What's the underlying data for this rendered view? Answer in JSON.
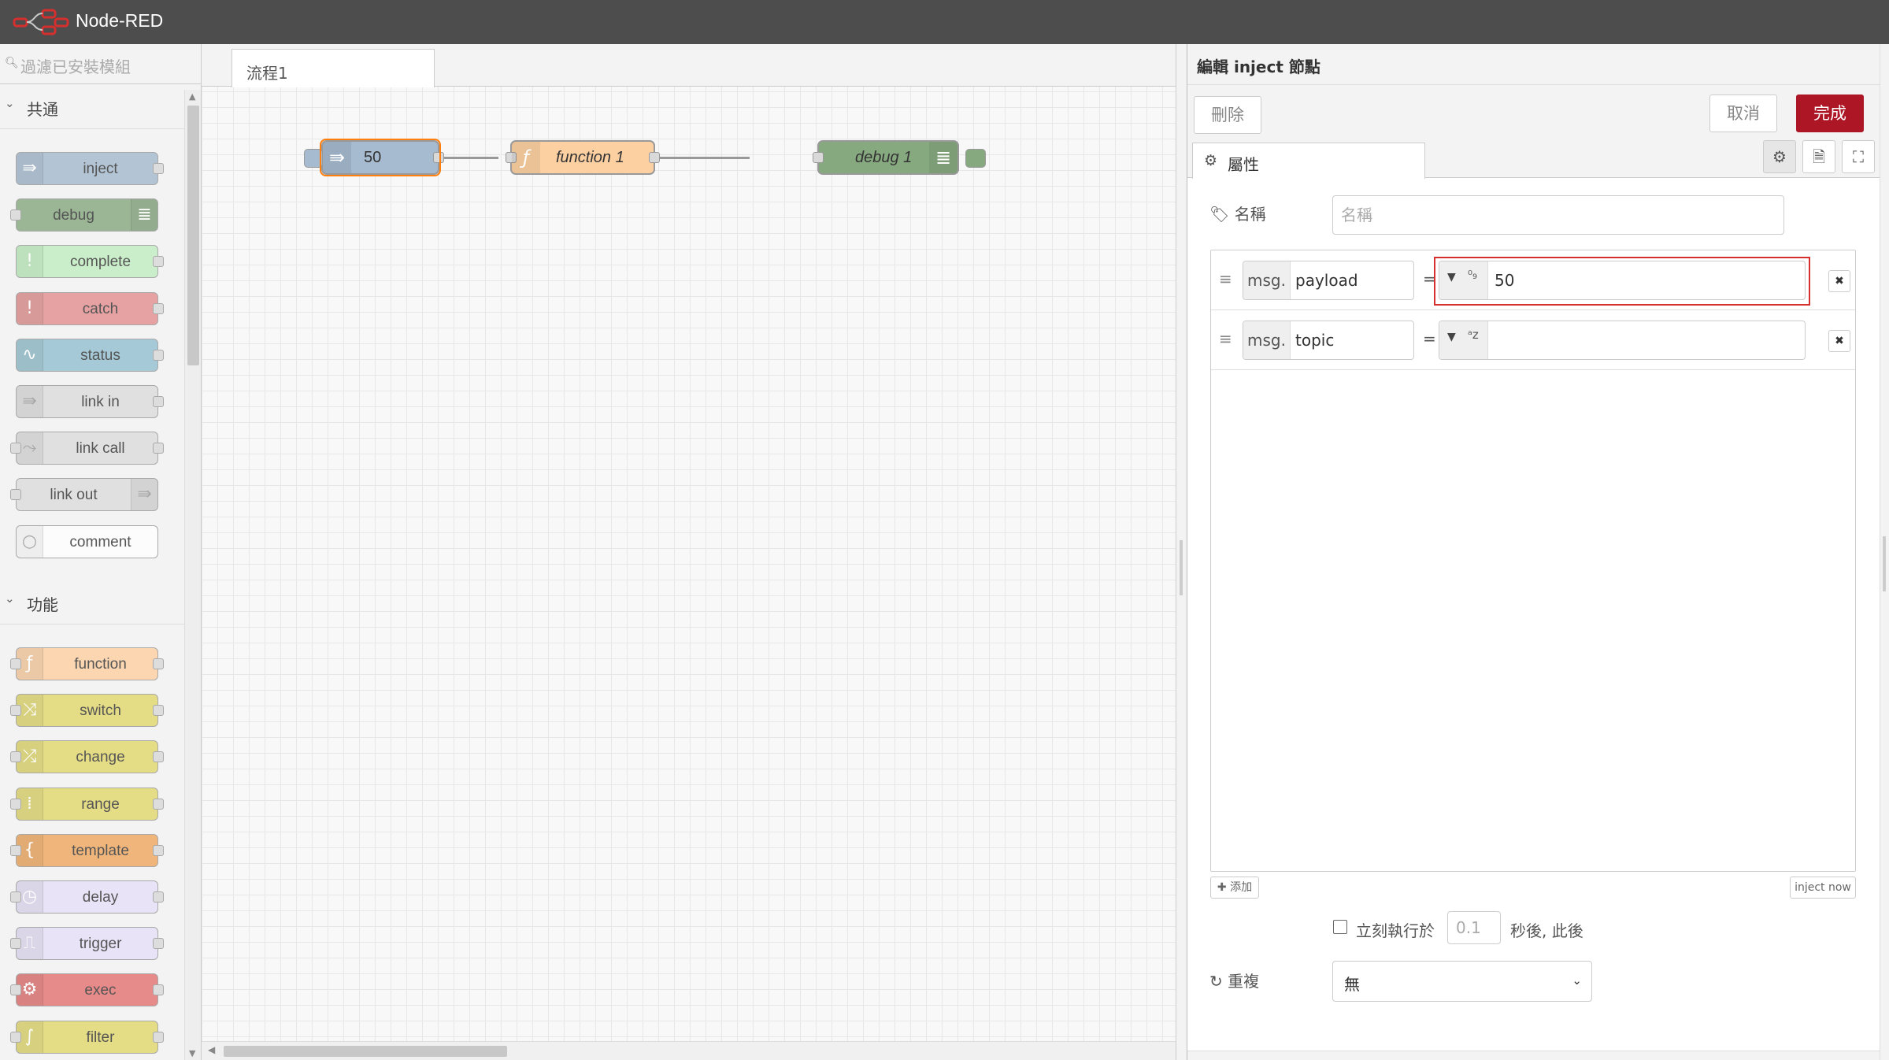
{
  "app": {
    "title": "Node-RED"
  },
  "palette": {
    "search_placeholder": "過濾已安裝模組",
    "categories": [
      {
        "label": "共通",
        "nodes": [
          {
            "label": "inject",
            "color": "#a6bbcf",
            "icon": "arrow-right-icon",
            "glyph": "⇛"
          },
          {
            "label": "debug",
            "color": "#87a980",
            "icon": "list-icon",
            "glyph": "≣"
          },
          {
            "label": "complete",
            "color": "#c0edc0",
            "icon": "exclamation-icon",
            "glyph": "!"
          },
          {
            "label": "catch",
            "color": "#e49191",
            "icon": "exclamation-icon",
            "glyph": "!"
          },
          {
            "label": "status",
            "color": "#94c1d0",
            "icon": "pulse-icon",
            "glyph": "∿"
          },
          {
            "label": "link in",
            "color": "#dddddd",
            "icon": "link-in-icon",
            "glyph": "⇛"
          },
          {
            "label": "link call",
            "color": "#dddddd",
            "icon": "link-call-icon",
            "glyph": "⤳"
          },
          {
            "label": "link out",
            "color": "#dddddd",
            "icon": "link-out-icon",
            "glyph": "⇛"
          },
          {
            "label": "comment",
            "color": "#ffffff",
            "icon": "comment-icon",
            "glyph": "○"
          }
        ]
      },
      {
        "label": "功能",
        "nodes": [
          {
            "label": "function",
            "color": "#fdd0a2",
            "icon": "function-icon",
            "glyph": "ƒ"
          },
          {
            "label": "switch",
            "color": "#e2d96e",
            "icon": "switch-icon",
            "glyph": "⤨"
          },
          {
            "label": "change",
            "color": "#e2d96e",
            "icon": "change-icon",
            "glyph": "⤮"
          },
          {
            "label": "range",
            "color": "#e2d96e",
            "icon": "range-icon",
            "glyph": "⁞"
          },
          {
            "label": "template",
            "color": "#f0a860",
            "icon": "template-icon",
            "glyph": "{"
          },
          {
            "label": "delay",
            "color": "#e6e0f8",
            "icon": "clock-icon",
            "glyph": "◷"
          },
          {
            "label": "trigger",
            "color": "#e6e0f8",
            "icon": "trigger-icon",
            "glyph": "⎍"
          },
          {
            "label": "exec",
            "color": "#e57373",
            "icon": "cog-icon",
            "glyph": "⚙"
          },
          {
            "label": "filter",
            "color": "#e2d96e",
            "icon": "filter-icon",
            "glyph": "∫"
          }
        ]
      }
    ]
  },
  "workspace": {
    "flow_tab": "流程1",
    "nodes": [
      {
        "label": "50",
        "color": "#a6bbcf",
        "icon": "arrow-right-icon"
      },
      {
        "label": "function 1",
        "color": "#fdd0a2",
        "icon": "function-icon"
      },
      {
        "label": "debug 1",
        "color": "#87a980",
        "icon": "list-icon"
      }
    ]
  },
  "editor": {
    "title": "編輯 inject 節點",
    "delete_label": "刪除",
    "cancel_label": "取消",
    "done_label": "完成",
    "done_color": "#ad1625",
    "tab_properties": "屬性",
    "name_label": "名稱",
    "name_placeholder": "名稱",
    "props": [
      {
        "prefix": "msg.",
        "key": "payload",
        "type_icon": "⁰₉",
        "value": "50"
      },
      {
        "prefix": "msg.",
        "key": "topic",
        "type_icon": "ᵃz",
        "value": ""
      }
    ],
    "eq": "=",
    "add_label": "添加",
    "inject_now_label": "inject now",
    "once_label": "立刻執行於",
    "once_delay": "0.1",
    "once_suffix": "秒後, 此後",
    "repeat_label": "重複",
    "repeat_value": "無"
  }
}
